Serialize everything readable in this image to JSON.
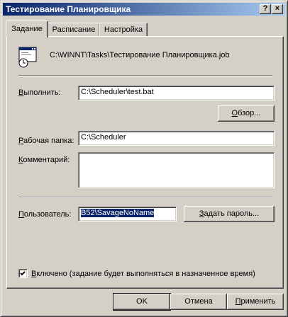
{
  "window": {
    "title": "Тестирование Планировщика"
  },
  "titlebar_buttons": {
    "help": "?",
    "close": "×"
  },
  "tabs": [
    {
      "label": "Задание",
      "active": true
    },
    {
      "label": "Расписание",
      "active": false
    },
    {
      "label": "Настройка",
      "active": false
    }
  ],
  "task": {
    "icon": "scheduled-task-icon",
    "path": "C:\\WINNT\\Tasks\\Тестирование Планировщика.job"
  },
  "run": {
    "label_mnemonic": "В",
    "label_rest": "ыполнить:",
    "value": "C:\\Scheduler\\test.bat"
  },
  "browse_button": {
    "mnemonic": "О",
    "rest": "бзор..."
  },
  "working_folder": {
    "label_mnemonic": "Р",
    "label_rest": "абочая папка:",
    "value": "C:\\Scheduler"
  },
  "comment": {
    "label_mnemonic": "К",
    "label_rest": "омментарий:",
    "value": ""
  },
  "user": {
    "label_mnemonic": "П",
    "label_rest": "ользователь:",
    "value": "B52\\SavageNoName"
  },
  "set_password_button": {
    "mnemonic": "З",
    "rest": "адать пароль..."
  },
  "enabled": {
    "checked": true,
    "mnemonic": "В",
    "rest": "ключено (задание будет выполняться в назначенное время)"
  },
  "footer": {
    "ok": "OK",
    "cancel": "Отмена",
    "apply_mnemonic": "П",
    "apply_rest": "рименить"
  }
}
